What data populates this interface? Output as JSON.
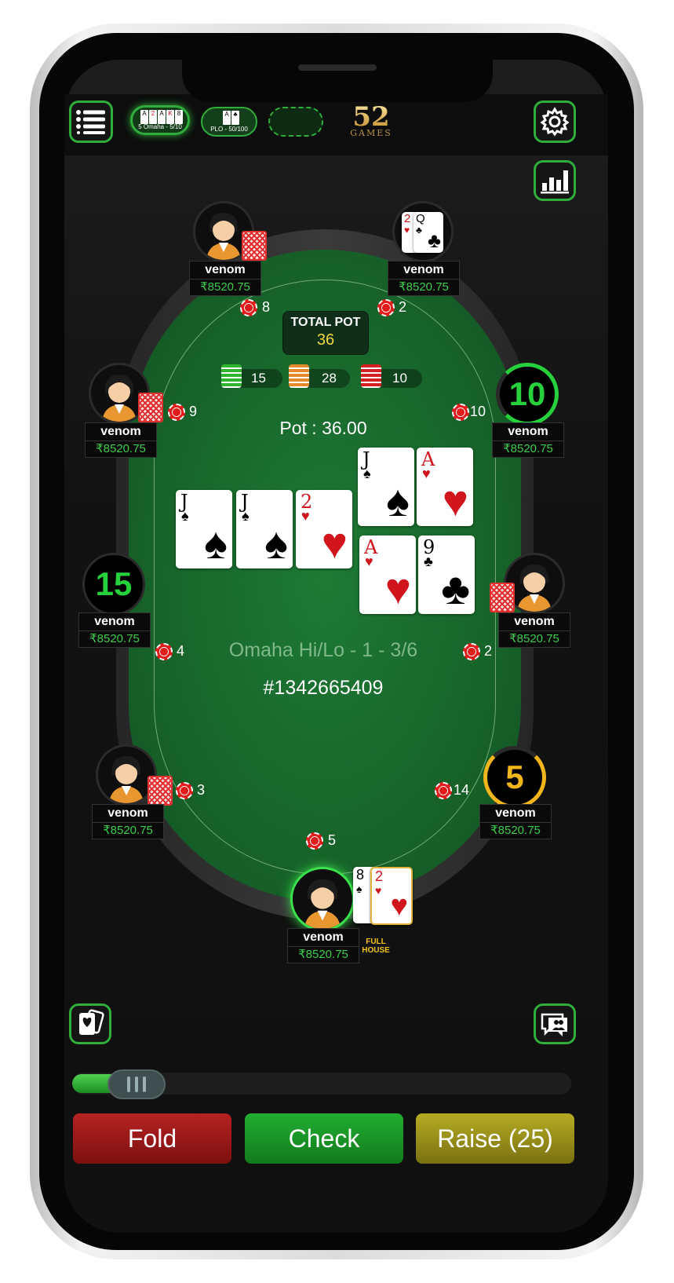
{
  "topbar": {
    "tab1_label": "5 Omaha - 5/10",
    "tab2_label": "PLO - 50/100",
    "logo_number": "52",
    "logo_word": "GAMES"
  },
  "pot": {
    "total_label": "TOTAL POT",
    "total_value": "36",
    "pot_text": "Pot : 36.00",
    "side_pots": [
      "15",
      "28",
      "10"
    ]
  },
  "table": {
    "game_name": "Omaha Hi/Lo - 1 - 3/6",
    "hand_id": "#1342665409"
  },
  "seats": [
    {
      "name": "venom",
      "balance": "₹8520.75",
      "bet": "8"
    },
    {
      "name": "venom",
      "balance": "₹8520.75",
      "bet": "2"
    },
    {
      "name": "venom",
      "balance": "₹8520.75",
      "bet": "9"
    },
    {
      "name": "venom",
      "balance": "₹8520.75",
      "bet": "10",
      "timer": "10"
    },
    {
      "name": "venom",
      "balance": "₹8520.75",
      "bet": "4",
      "timer": "15"
    },
    {
      "name": "venom",
      "balance": "₹8520.75",
      "bet": "2"
    },
    {
      "name": "venom",
      "balance": "₹8520.75",
      "bet": "3"
    },
    {
      "name": "venom",
      "balance": "₹8520.75",
      "bet": "14",
      "timer": "5"
    },
    {
      "name": "venom",
      "balance": "₹8520.75",
      "bet": "5",
      "hand_label": "FULL HOUSE"
    }
  ],
  "seat2_cards": [
    {
      "rank": "2",
      "suit": "♥"
    },
    {
      "rank": "Q",
      "suit": "♣"
    }
  ],
  "community_cards": [
    {
      "rank": "J",
      "suit": "♠"
    },
    {
      "rank": "J",
      "suit": "♠"
    },
    {
      "rank": "2",
      "suit": "♥"
    },
    {
      "rank": "J",
      "suit": "♠"
    },
    {
      "rank": "A",
      "suit": "♥"
    },
    {
      "rank": "A",
      "suit": "♥"
    },
    {
      "rank": "9",
      "suit": "♣"
    }
  ],
  "hero_cards": [
    {
      "rank": "8",
      "suit": "♠"
    },
    {
      "rank": "2",
      "suit": "♥"
    }
  ],
  "actions": {
    "fold": "Fold",
    "check": "Check",
    "raise": "Raise (25)"
  },
  "slider_value_fraction": 0.1,
  "colors": {
    "accent_green": "#2fae3c",
    "fold": "#a11a1a",
    "check": "#1c9a2c",
    "raise": "#a39a1c"
  }
}
